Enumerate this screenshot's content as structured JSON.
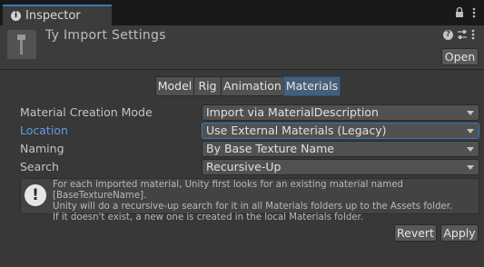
{
  "tabbar": {
    "tab_label": "Inspector"
  },
  "header": {
    "title": "Ty Import Settings",
    "open_label": "Open"
  },
  "toolbar": {
    "tabs": [
      {
        "label": "Model"
      },
      {
        "label": "Rig"
      },
      {
        "label": "Animation"
      },
      {
        "label": "Materials",
        "active": true
      }
    ]
  },
  "properties": [
    {
      "label": "Material Creation Mode",
      "value": "Import via MaterialDescription"
    },
    {
      "label": "Location",
      "value": "Use External Materials (Legacy)"
    },
    {
      "label": "Naming",
      "value": "By Base Texture Name"
    },
    {
      "label": "Search",
      "value": "Recursive-Up"
    }
  ],
  "helpbox": {
    "text": "For each imported material, Unity first looks for an existing material named [BaseTextureName].\nUnity will do a recursive-up search for it in all Materials folders up to the Assets folder.\nIf it doesn't exist, a new one is created in the local Materials folder."
  },
  "footer": {
    "revert_label": "Revert",
    "apply_label": "Apply"
  },
  "colors": {
    "accent": "#3a79bb",
    "focused_label": "#5f9ee6",
    "active_tab": "#46607c"
  }
}
